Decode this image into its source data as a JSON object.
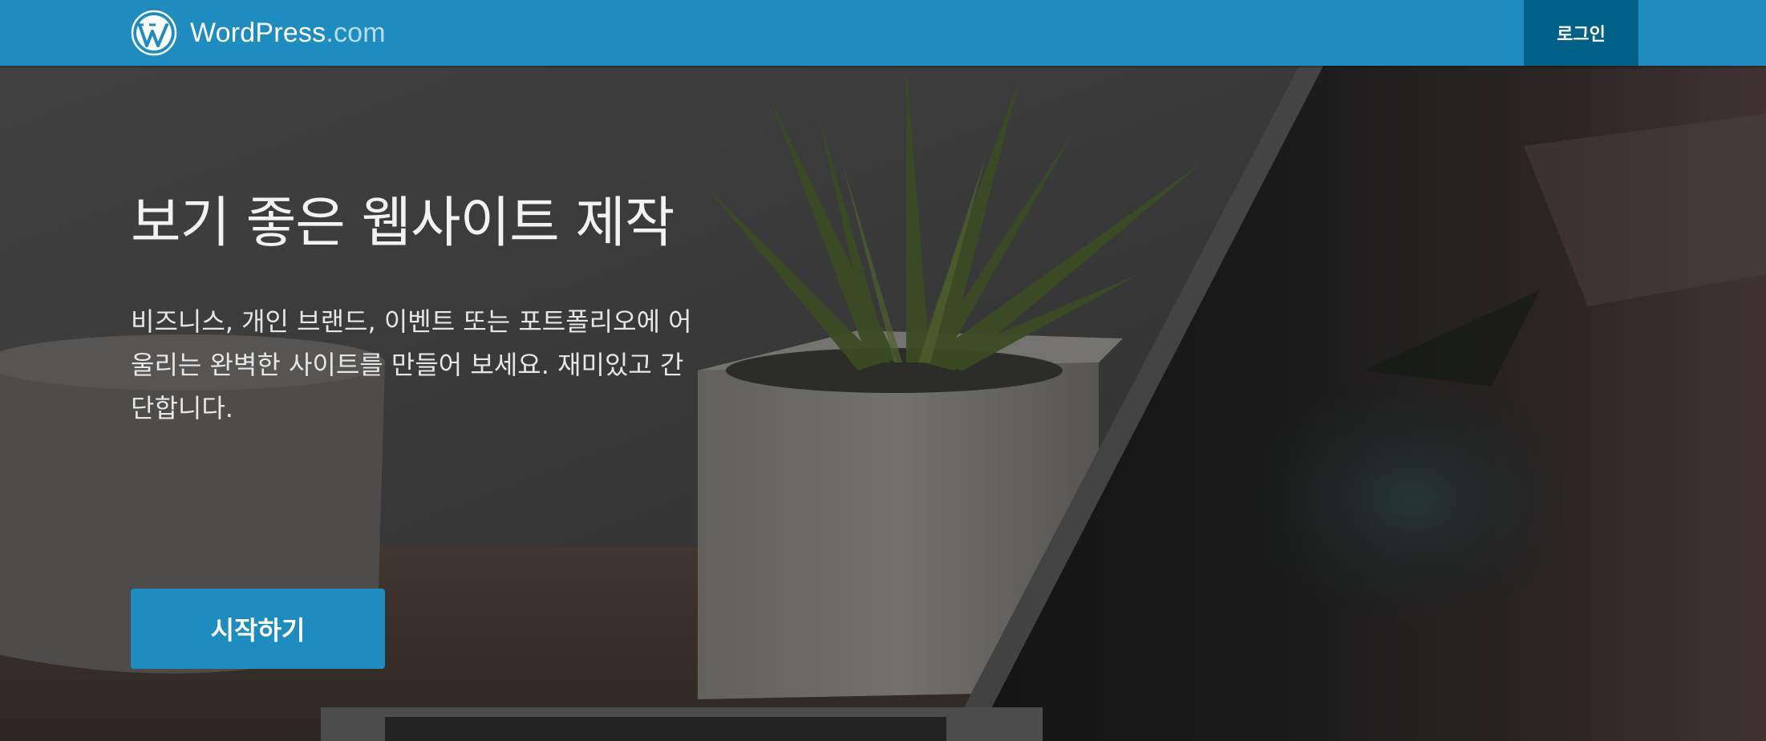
{
  "header": {
    "brand_name": "WordPress",
    "brand_suffix": ".com",
    "login_label": "로그인"
  },
  "hero": {
    "title": "보기 좋은 웹사이트 제작",
    "description": "비즈니스, 개인 브랜드, 이벤트 또는 포트폴리오에 어울리는 완벽한 사이트를 만들어 보세요. 재미있고 간단합니다.",
    "cta_label": "시작하기"
  },
  "colors": {
    "brand_blue": "#1e8cbe",
    "login_bg": "#016087"
  },
  "icons": {
    "logo": "wordpress-logo-icon"
  }
}
